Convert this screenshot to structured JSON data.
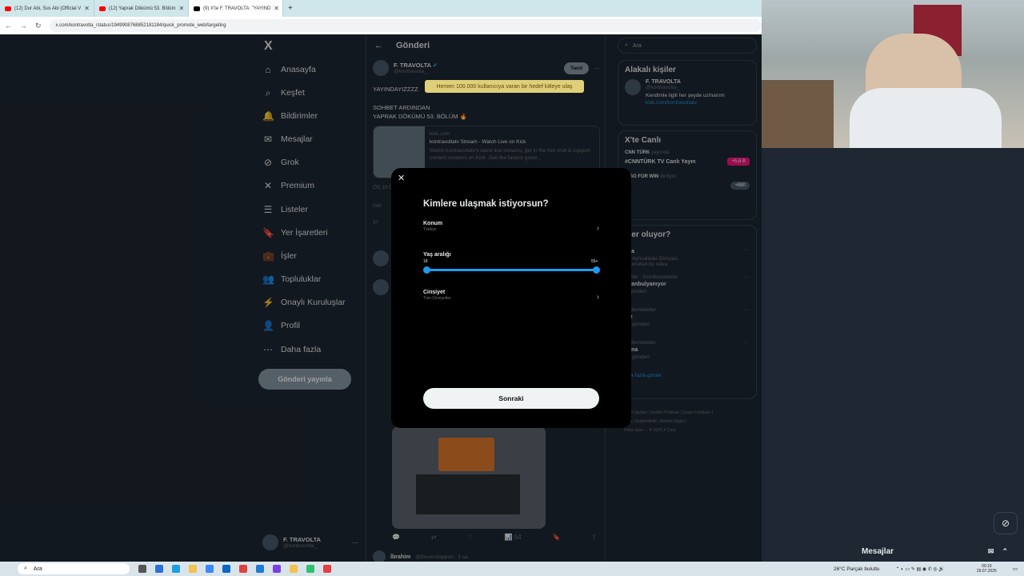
{
  "browser": {
    "tabs": [
      {
        "title": "(12) Dur Abi, Sus Abi (Official V",
        "type": "youtube"
      },
      {
        "title": "(12) Yaprak Dökümü 53. Bölüm",
        "type": "youtube"
      },
      {
        "title": "(9) X'te F. TRAVOLTA: \"YAYIND",
        "type": "x",
        "active": true
      }
    ],
    "new_tab": "+",
    "url": "x.com/kontravolta_/status/1949908768852181184/quick_promote_web/targeting"
  },
  "nav": {
    "logo": "X",
    "items": [
      {
        "label": "Anasayfa",
        "icon": "home-icon",
        "glyph": "⌂"
      },
      {
        "label": "Keşfet",
        "icon": "search-icon",
        "glyph": "⌕"
      },
      {
        "label": "Bildirimler",
        "icon": "bell-icon",
        "glyph": "🔔"
      },
      {
        "label": "Mesajlar",
        "icon": "envelope-icon",
        "glyph": "✉"
      },
      {
        "label": "Grok",
        "icon": "grok-icon",
        "glyph": "⊘"
      },
      {
        "label": "Premium",
        "icon": "x-premium-icon",
        "glyph": "✕"
      },
      {
        "label": "Listeler",
        "icon": "list-icon",
        "glyph": "☰"
      },
      {
        "label": "Yer İşaretleri",
        "icon": "bookmark-icon",
        "glyph": "🔖"
      },
      {
        "label": "İşler",
        "icon": "briefcase-icon",
        "glyph": "💼"
      },
      {
        "label": "Topluluklar",
        "icon": "people-icon",
        "glyph": "👥"
      },
      {
        "label": "Onaylı Kuruluşlar",
        "icon": "lightning-icon",
        "glyph": "⚡"
      },
      {
        "label": "Profil",
        "icon": "person-icon",
        "glyph": "👤"
      },
      {
        "label": "Daha fazla",
        "icon": "more-circle-icon",
        "glyph": "⋯"
      }
    ],
    "post_button": "Gönderi yayınla",
    "account_name": "F. TRAVOLTA",
    "account_handle": "@kontravolta_",
    "account_more": "···"
  },
  "main": {
    "header_title": "Gönderi",
    "back_glyph": "←",
    "author_name": "F. TRAVOLTA",
    "author_handle": "@kontravolta_",
    "promote_button": "Tanıt",
    "more_glyph": "···",
    "tweet_line1": "YAYINDAYIZZZZ",
    "tweet_line2": "SOHBET ARDINDAN",
    "tweet_line3": "YAPRAK DÖKÜMÜ 53. BÖLÜM 🔥",
    "card_domain": "kick.com",
    "card_title": "kontravoltatv Stream - Watch Live on Kick",
    "card_desc": "Watch kontravoltatv's latest live streams, get in the live chat & support content creators on Kick. Join the fastest growi...",
    "timestamp_partial": "ÖS 10:0",
    "views_partial": "Gör",
    "reply_partial": "37",
    "action_views": "54",
    "reply_user": "İbrahim",
    "reply_handle": "@lboverstappen · 1 sa"
  },
  "tooltip": "Hemen 100.000 kullanıcıya varan bir hedef kitleye ulaş",
  "modal": {
    "close_glyph": "✕",
    "title": "Kimlere ulaşmak istiyorsun?",
    "location_label": "Konum",
    "location_value": "Türkiye",
    "age_label": "Yaş aralığı",
    "age_min": "18",
    "age_max": "55+",
    "gender_label": "Cinsiyet",
    "gender_value": "Tüm Cinsiyetler",
    "chevron_glyph": "›",
    "next_button": "Sonraki"
  },
  "right": {
    "search_placeholder": "Ara",
    "related_title": "Alakalı kişiler",
    "related_name": "F. TRAVOLTA",
    "related_handle": "@kontravolta_",
    "related_bio": "Kendimle ilgili her şeyde uzmanım",
    "related_link": "kick.com/kontravoltatv",
    "live_title": "X'te Canlı",
    "live1_source": "CNN TÜRK",
    "live1_status": "yayında",
    "live1_title": "#CNNTÜRK TV Canlı Yayın",
    "live1_count": "+5,6 B",
    "live2_source": "ZIGO FOR WIN",
    "live2_status": "dinliyor",
    "live2_title": "S",
    "live2_count": "+880",
    "trends_title": "eler oluyor?",
    "trends": [
      {
        "meta": "",
        "name": "dea",
        "posts": "ea Ayrıcalıklar Dünyası"
      },
      {
        "meta": "berler · Gündemdekiler",
        "name": "İstanbulyanıyor",
        "posts": "4 gönderi"
      },
      {
        "meta": "ündemdekiler",
        "name": "ğız",
        "posts": "37 gönderi"
      },
      {
        "meta": "ündemdekiler",
        "name": "mina",
        "posts": "71 gönderi"
      }
    ],
    "promoted": "Promoted by odea",
    "show_more": "aha fazla göster",
    "footer1": "izmet Şartları | Gizlilik Politikası | Çerez Politikası |",
    "footer2": "rişim | Erişilebilirlik | Reklam bilgisi |",
    "footer3": "Daha fazla ··· © 2025 X Corp."
  },
  "messages_drawer": {
    "title": "Mesajlar"
  },
  "taskbar": {
    "search": "Ara",
    "weather": "26°C  Parçalı bulutlu",
    "time": "00:19",
    "date": "29.07.2025"
  }
}
